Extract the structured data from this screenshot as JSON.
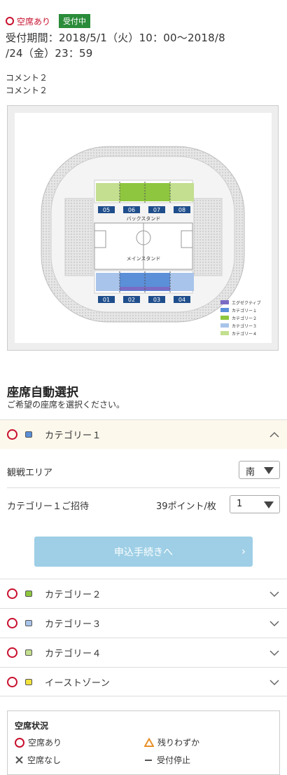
{
  "header": {
    "status_label": "空席あり",
    "badge": "受付中",
    "period_line1": "受付期間：2018/5/1（火）10：00〜2018/8",
    "period_line2": "/24（金）23：59",
    "comments": [
      "コメント２",
      "コメント２"
    ]
  },
  "stadium_map": {
    "back_stand": "バックスタンド",
    "main_stand": "メインスタンド",
    "top_blocks": [
      "05",
      "06",
      "07",
      "08"
    ],
    "bottom_blocks": [
      "01",
      "02",
      "03",
      "04"
    ],
    "legend": [
      {
        "label": "エグゼクティブ",
        "color": "#7a6bc4"
      },
      {
        "label": "カテゴリー１",
        "color": "#5b8fd8"
      },
      {
        "label": "カテゴリー２",
        "color": "#8ec63f"
      },
      {
        "label": "カテゴリー３",
        "color": "#a9c4ea"
      },
      {
        "label": "カテゴリー４",
        "color": "#c3df8f"
      }
    ]
  },
  "selection": {
    "title": "座席自動選択",
    "subtitle": "ご希望の座席を選択ください。"
  },
  "category1": {
    "label": "カテゴリー１",
    "square_color": "#5b8fd8",
    "area_label": "観戦エリア",
    "area_value": "南",
    "invite_label": "カテゴリー１ご招待",
    "points_label": "39ポイント/枚",
    "quantity_value": "1",
    "apply_label": "申込手続きへ",
    "apply_arrow": "›"
  },
  "categories": [
    {
      "label": "カテゴリー２",
      "square_color": "#8ec63f"
    },
    {
      "label": "カテゴリー３",
      "square_color": "#a9c4ea"
    },
    {
      "label": "カテゴリー４",
      "square_color": "#c3df8f"
    },
    {
      "label": "イーストゾーン",
      "square_color": "#f2e23a"
    }
  ],
  "availability_legend": {
    "title": "空席状況",
    "available": "空席あり",
    "few_left": "残りわずか",
    "sold_out": "空席なし",
    "stopped": "受付停止"
  },
  "colors": {
    "accent_red": "#c8102e",
    "badge_green": "#2a8c3a",
    "button_blue": "#9ecfe6"
  }
}
